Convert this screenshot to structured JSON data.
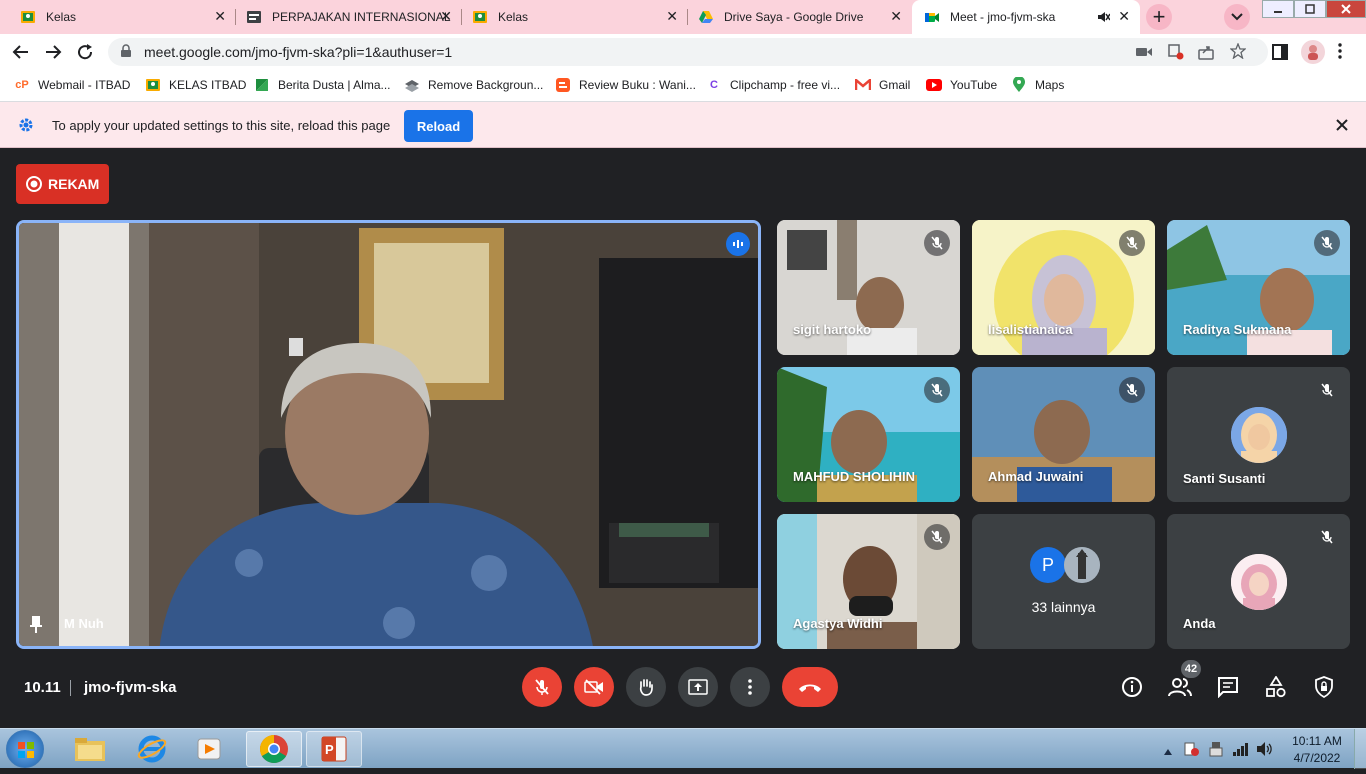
{
  "browser": {
    "tabs": [
      {
        "title": "Kelas",
        "icon": "classroom-icon"
      },
      {
        "title": "PERPAJAKAN INTERNASIONAL",
        "icon": "doc-icon"
      },
      {
        "title": "Kelas",
        "icon": "classroom-icon"
      },
      {
        "title": "Drive Saya - Google Drive",
        "icon": "drive-icon"
      },
      {
        "title": "Meet - jmo-fjvm-ska",
        "icon": "meet-icon",
        "active": true
      }
    ],
    "close_glyph": "✕",
    "new_tab_glyph": "+",
    "url": "meet.google.com/jmo-fjvm-ska?pli=1&authuser=1",
    "bookmarks": [
      {
        "label": "Webmail - ITBAD",
        "icon": "cpanel-icon"
      },
      {
        "label": "KELAS ITBAD",
        "icon": "classroom-icon"
      },
      {
        "label": "Berita Dusta | Alma...",
        "icon": "bookmark-icon"
      },
      {
        "label": "Remove Backgroun...",
        "icon": "removebg-icon"
      },
      {
        "label": "Review Buku : Wani...",
        "icon": "blogger-icon"
      },
      {
        "label": "Clipchamp - free vi...",
        "icon": "clipchamp-icon"
      },
      {
        "label": "Gmail",
        "icon": "gmail-icon"
      },
      {
        "label": "YouTube",
        "icon": "youtube-icon"
      },
      {
        "label": "Maps",
        "icon": "maps-icon"
      }
    ],
    "infobar": {
      "message": "To apply your updated settings to this site, reload this page",
      "button": "Reload"
    }
  },
  "meet": {
    "record_label": "REKAM",
    "main_speaker": "M Nuh",
    "participants": [
      {
        "name": "sigit hartoko",
        "muted": true
      },
      {
        "name": "lisalistianaica",
        "muted": true
      },
      {
        "name": "Raditya Sukmana",
        "muted": true
      },
      {
        "name": "MAHFUD SHOLIHIN",
        "muted": true
      },
      {
        "name": "Ahmad Juwaini",
        "muted": true
      },
      {
        "name": "Santi Susanti",
        "muted": true
      },
      {
        "name": "Agastya Widhi",
        "muted": true
      },
      {
        "name": "33 lainnya",
        "initial": "P",
        "muted": false
      },
      {
        "name": "Anda",
        "muted": true
      }
    ],
    "time": "10.11",
    "meeting_code": "jmo-fjvm-ska",
    "participant_count": "42",
    "colors": {
      "accent_red": "#ea4335",
      "active_border": "#8ab4f8",
      "background": "#202124"
    }
  },
  "taskbar": {
    "time": "10:11 AM",
    "date": "4/7/2022"
  }
}
